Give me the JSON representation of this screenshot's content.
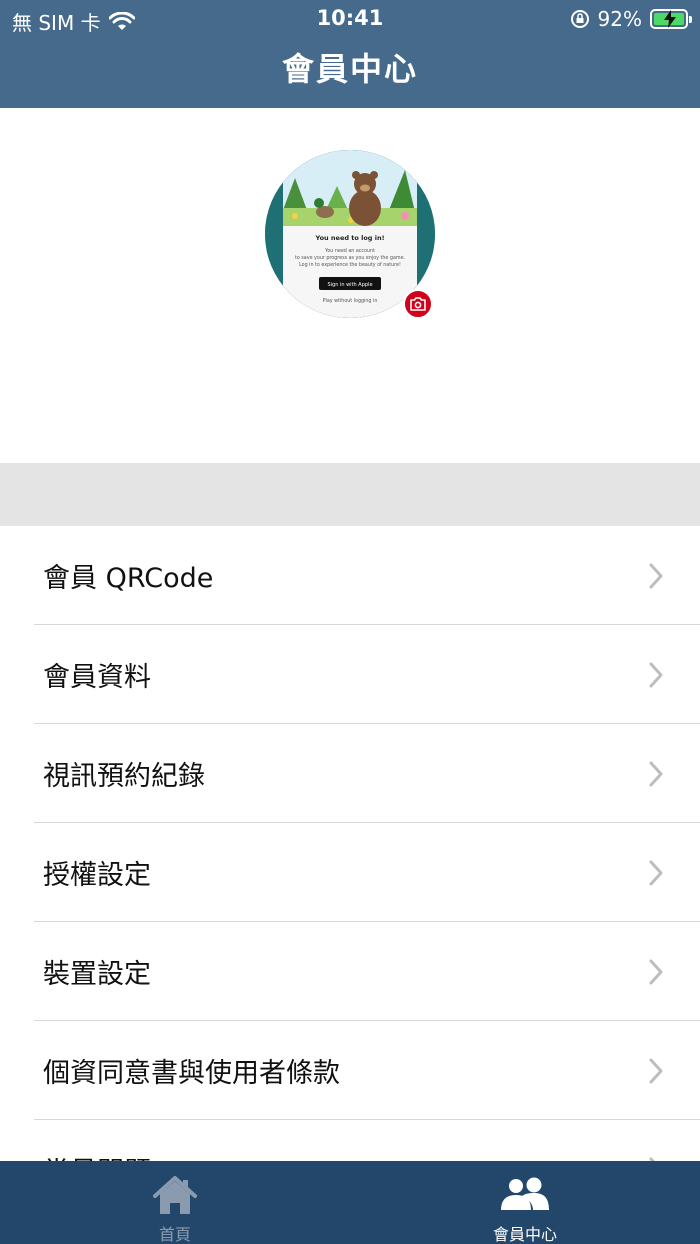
{
  "status_bar": {
    "carrier": "無 SIM 卡",
    "time": "10:41",
    "battery_percent": "92%"
  },
  "header": {
    "title": "會員中心"
  },
  "avatar": {
    "icon": "user-avatar",
    "camera_icon": "camera-icon"
  },
  "menu": {
    "items": [
      {
        "label": "會員 QRCode"
      },
      {
        "label": "會員資料"
      },
      {
        "label": "視訊預約紀錄"
      },
      {
        "label": "授權設定"
      },
      {
        "label": "裝置設定"
      },
      {
        "label": "個資同意書與使用者條款"
      },
      {
        "label": "常見問題"
      }
    ]
  },
  "tab_bar": {
    "tabs": [
      {
        "label": "首頁",
        "icon": "home-icon",
        "active": false
      },
      {
        "label": "會員中心",
        "icon": "members-icon",
        "active": true
      }
    ]
  },
  "colors": {
    "header_bg": "#456a8c",
    "tab_bar_bg": "#22476b",
    "accent_red": "#d0021b",
    "battery_green": "#4cd964"
  }
}
